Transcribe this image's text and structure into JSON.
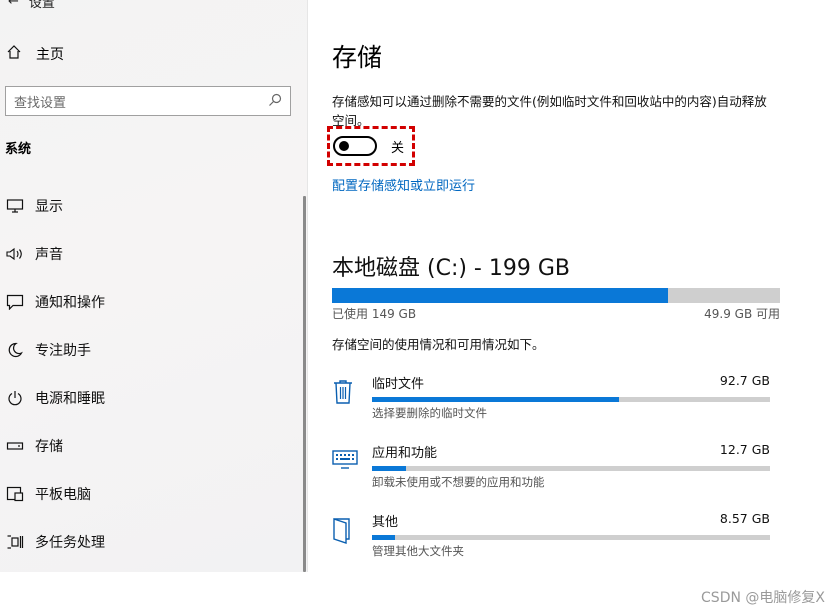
{
  "sidebar": {
    "top_title": "设置",
    "home_label": "主页",
    "search_placeholder": "查找设置",
    "section": "系统",
    "items": [
      {
        "label": "显示",
        "icon": "monitor-icon"
      },
      {
        "label": "声音",
        "icon": "speaker-icon"
      },
      {
        "label": "通知和操作",
        "icon": "notification-icon"
      },
      {
        "label": "专注助手",
        "icon": "moon-icon"
      },
      {
        "label": "电源和睡眠",
        "icon": "power-icon"
      },
      {
        "label": "存储",
        "icon": "storage-icon"
      },
      {
        "label": "平板电脑",
        "icon": "tablet-icon"
      },
      {
        "label": "多任务处理",
        "icon": "multitask-icon"
      }
    ]
  },
  "main": {
    "title": "存储",
    "description": "存储感知可以通过删除不需要的文件(例如临时文件和回收站中的内容)自动释放空间。",
    "toggle_state": "关",
    "toggle_on": false,
    "link": "配置存储感知或立即运行",
    "disk": {
      "title": "本地磁盘 (C:) - 199 GB",
      "used_label": "已使用 149 GB",
      "free_label": "49.9 GB 可用",
      "used_fraction": 0.75
    },
    "usage_desc": "存储空间的使用情况和可用情况如下。",
    "categories": [
      {
        "name": "临时文件",
        "size": "92.7 GB",
        "desc": "选择要删除的临时文件",
        "fraction": 0.62,
        "icon": "trash-icon"
      },
      {
        "name": "应用和功能",
        "size": "12.7 GB",
        "desc": "卸载未使用或不想要的应用和功能",
        "fraction": 0.085,
        "icon": "keyboard-icon"
      },
      {
        "name": "其他",
        "size": "8.57 GB",
        "desc": "管理其他大文件夹",
        "fraction": 0.057,
        "icon": "folder-icon"
      }
    ]
  },
  "watermark": "CSDN @电脑修复X",
  "colors": {
    "accent": "#0a78d7",
    "link": "#0067c0",
    "highlight": "#d20000"
  }
}
